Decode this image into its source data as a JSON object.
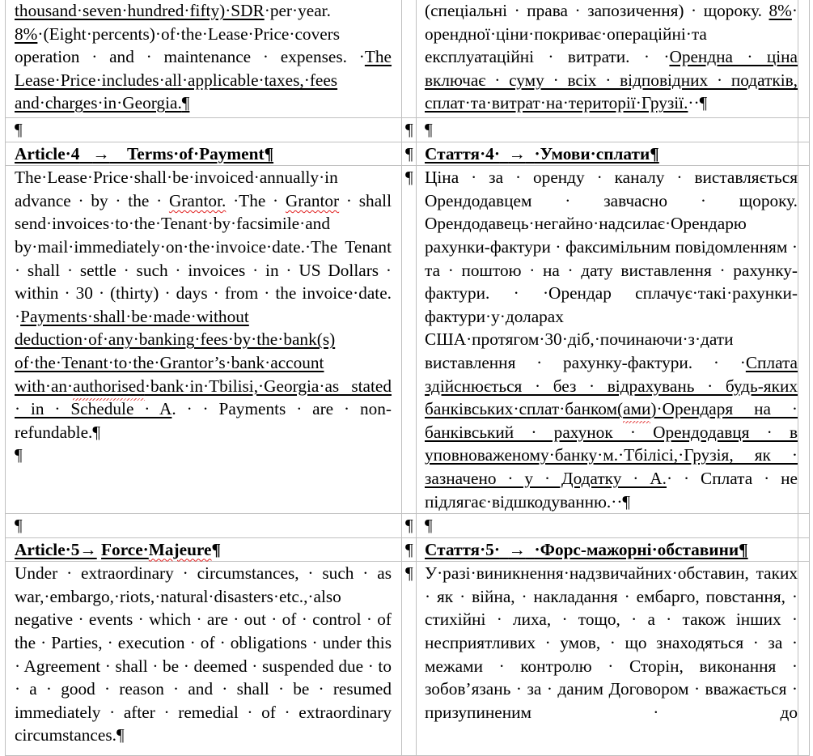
{
  "document": {
    "marks": {
      "pilcrow": "¶",
      "tab_arrow": "→"
    },
    "article3_tail": {
      "en": {
        "segments": [
          {
            "text": "thousand·seven·hundred·fifty)·SDR",
            "underline": true
          },
          {
            "text": "·per·year. ",
            "underline": false
          },
          {
            "text": "8%",
            "underline": true
          },
          {
            "text": "·(Eight·percents)·of·the·Lease·Price·covers operation · and · maintenance · expenses.  ·",
            "underline": false
          },
          {
            "text": "The Lease·Price·includes·all·applicable·taxes,·fees and·charges·in·Georgia.",
            "underline": true
          },
          {
            "text": "¶",
            "underline": true
          }
        ]
      },
      "uk": {
        "segments": [
          {
            "text": "(спеціальні · права · запозичення) · щороку. ",
            "underline": false
          },
          {
            "text": "8%",
            "underline": true
          },
          {
            "text": "· орендної·ціни·покриває·операційні·та експлуатаційні · витрати. ·  ·",
            "underline": false
          },
          {
            "text": "Орендна · ціна включає · суму · всіх · відповідних · податків, сплат·та·витрат·на·території·Грузії.",
            "underline": true
          },
          {
            "text": "··¶",
            "underline": false
          }
        ]
      }
    },
    "article4": {
      "en": {
        "heading_number": "Article·4",
        "heading_title": "Terms·of·Payment¶",
        "body": {
          "part1": "The·Lease·Price·shall·be·invoiced·annually·in advance · by · the · ",
          "grantor1": "Grantor.",
          "part2": " ·The · ",
          "grantor2": "Grantor",
          "part3": " · shall send·invoices·to·the·Tenant·by·facsimile·and by·mail·immediately·on·the·invoice·date.·The Tenant · shall · settle · such · invoices · in · US Dollars · within · 30 · (thirty) · days · from · the invoice·date. ·",
          "underlined1": "Payments·shall·be·made·without deduction·of·any·banking·fees·by·the·bank(s) of·the·Tenant·to·the·Grantor’s·bank·account with·an·",
          "authorised": "authorised",
          "underlined2": "·bank·in·Tbilisi,·Georgia·as stated · in · Schedule · A",
          "part4": ". · · Payments · are · non-refundable.¶"
        },
        "trailing_pilcrow": "¶"
      },
      "uk": {
        "heading_number": "Стаття·4·",
        "heading_title": "·Умови·сплати¶",
        "body": {
          "part1": "Ціна · за · оренду · каналу · виставляється Орендодавцем · завчасно · щороку. Орендодавець·негайно·надсилає·Орендарю рахунки-фактури · факсимільним повідомленням · та · поштою · на · дату виставлення · рахунку-фактури. · ·Орендар сплачує·такі·рахунки-фактури·у·доларах США·протягом·30·діб,·починаючи·з·дати виставлення · рахунку-фактури. ·  ·",
          "underlined1": "Сплата здійснюється · без · відрахувань · будь-яких банківських·сплат·банком(",
          "ami": "ами",
          "underlined2": ")·Орендаря на · банківський · рахунок · Орендодавця · в уповноваженому·банку·м.·Тбілісі,·Грузія, як · зазначено · у · Додатку · А.",
          "part2": "·  · Сплата · не підлягає·відшкодуванню.··¶"
        }
      }
    },
    "article5": {
      "en": {
        "heading_number": "Article·5",
        "heading_title_a": "Force·",
        "heading_title_b": "Majeure",
        "heading_pilcrow": "¶",
        "body": "Under · extraordinary · circumstances, · such · as war,·embargo,·riots,·natural·disasters·etc.,·also negative · events · which · are · out · of · control · of the · Parties, · execution · of · obligations · under this · Agreement · shall · be · deemed · suspended due · to · a · good · reason · and · shall · be · resumed immediately · after · remedial · of · extraordinary circumstances.¶"
      },
      "uk": {
        "heading_number": "Стаття·5·",
        "heading_title": "·Форс-мажорні·обставини¶",
        "body": "У·разі·виникнення·надзвичайних·обставин, таких · як · війна, · накладання · ембарго, повстання, · стихійні · лиха, · тощо, · а · також інших · несприятливих · умов, · що знаходяться · за · межами · контролю · Сторін, виконання · зобов’язань · за · даним Договором · вважається · призупиненим · до"
      }
    }
  }
}
